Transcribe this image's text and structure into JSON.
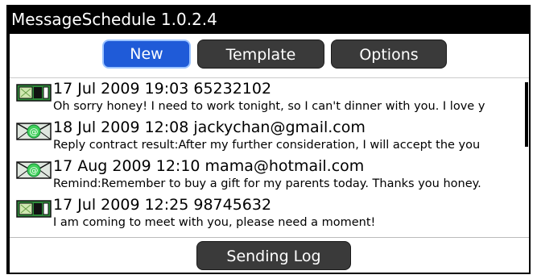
{
  "app": {
    "title": "MessageSchedule 1.0.2.4"
  },
  "toolbar": {
    "buttons": [
      {
        "label": "New",
        "selected": true
      },
      {
        "label": "Template",
        "selected": false
      },
      {
        "label": "Options",
        "selected": false
      }
    ]
  },
  "messages": [
    {
      "type": "sms",
      "icon": "sms-icon",
      "header": "17 Jul 2009 19:03 65232102",
      "body": "Oh sorry honey! I need to work tonight, so I can't dinner with you. I love y"
    },
    {
      "type": "email",
      "icon": "email-icon",
      "header": "18 Jul 2009 12:08 jackychan@gmail.com",
      "body": "Reply contract result:After my further consideration, I will accept the you"
    },
    {
      "type": "email",
      "icon": "email-icon",
      "header": "17 Aug 2009 12:10 mama@hotmail.com",
      "body": "Remind:Remember to buy a gift for my parents today. Thanks you honey."
    },
    {
      "type": "sms",
      "icon": "sms-icon",
      "header": "17 Jul 2009 12:25 98745632",
      "body": "I am coming to meet with you, please need a moment!"
    }
  ],
  "footer": {
    "sending_log_label": "Sending Log"
  },
  "colors": {
    "accent": "#1f5bd8",
    "button": "#3a3a3a",
    "titlebar": "#000000",
    "sms_icon": "#2e8b3a",
    "email_icon": "#3fd05a"
  }
}
